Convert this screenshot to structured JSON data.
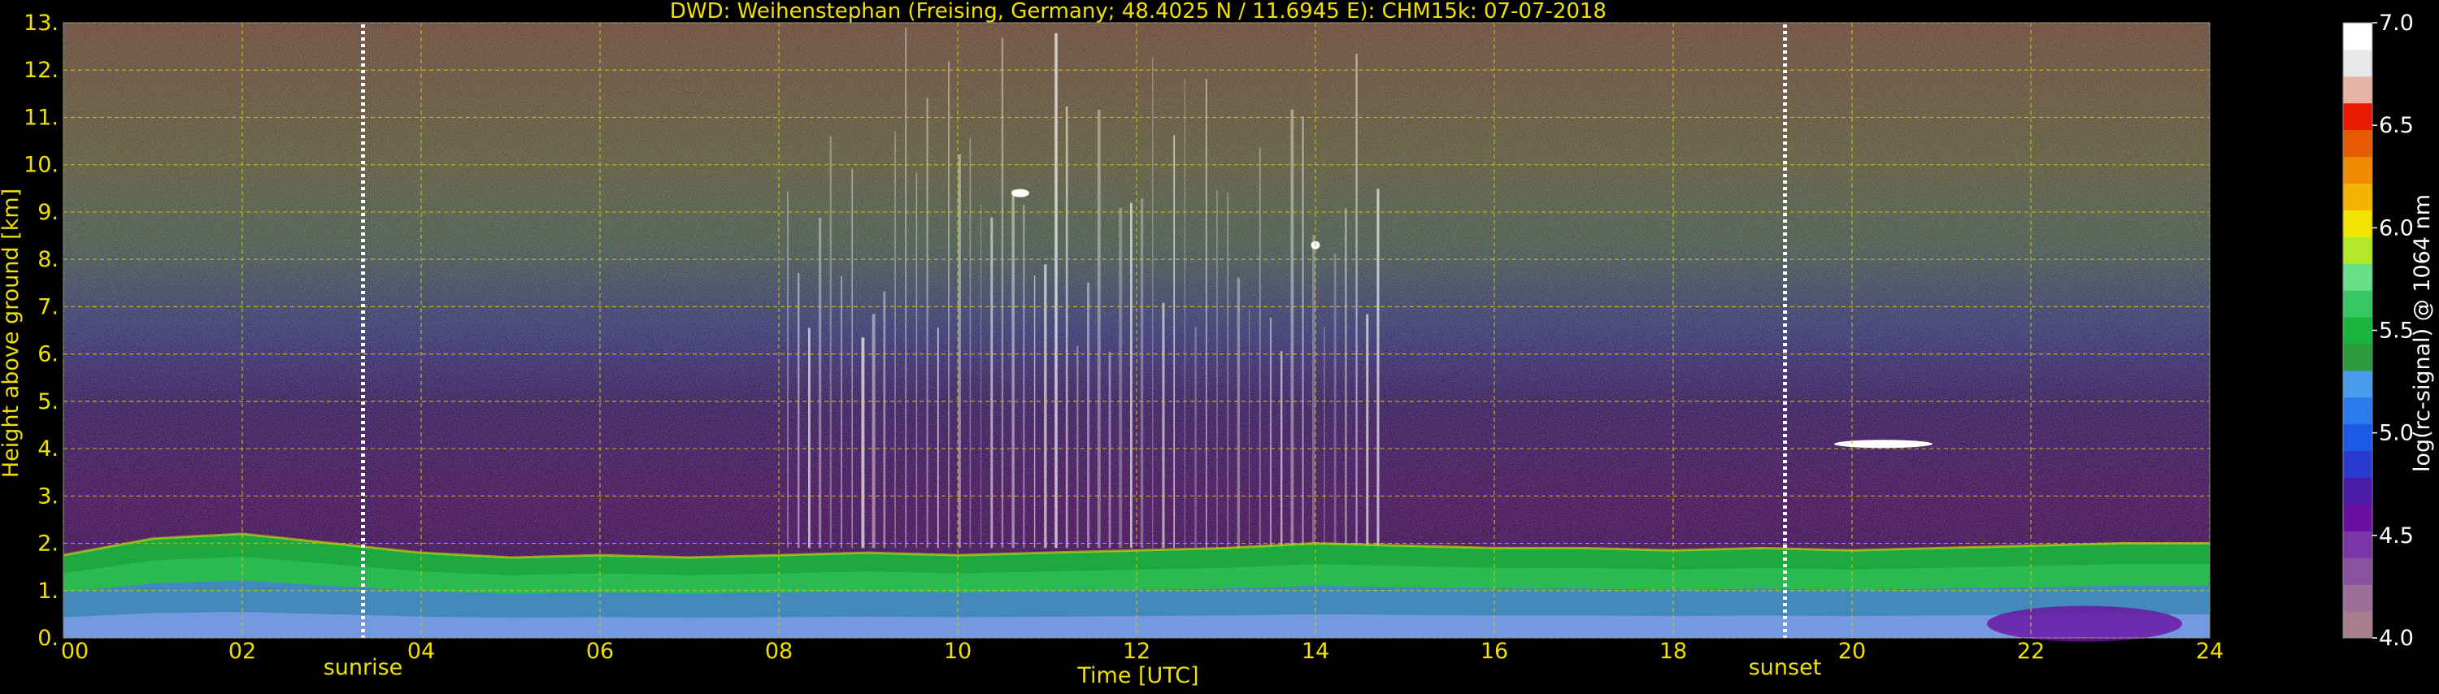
{
  "chart_data": {
    "type": "heatmap",
    "title": "DWD: Weihenstephan (Freising, Germany; 48.4025 N / 11.6945 E):    CHM15k: 07-07-2018",
    "xlabel": "Time [UTC]",
    "ylabel": "Height above ground [km]",
    "xlim": [
      0,
      24
    ],
    "ylim": [
      0,
      13
    ],
    "x_ticks": [
      "00",
      "02",
      "04",
      "06",
      "08",
      "10",
      "12",
      "14",
      "16",
      "18",
      "20",
      "22",
      "24"
    ],
    "y_ticks": [
      "0.",
      "1.",
      "2.",
      "3.",
      "4.",
      "5.",
      "6.",
      "7.",
      "8.",
      "9.",
      "10.",
      "11.",
      "12.",
      "13."
    ],
    "grid": true,
    "colorbar": {
      "label": "log(rc-signal) @ 1064 nm",
      "range": [
        4.0,
        7.0
      ],
      "ticks": [
        "4.0",
        "4.5",
        "5.0",
        "5.5",
        "6.0",
        "6.5",
        "7.0"
      ],
      "colors": [
        "#a57f8e",
        "#9a6f98",
        "#8a52a0",
        "#7a36a4",
        "#6a10a0",
        "#4a1aa8",
        "#2a3ad0",
        "#1a5ae6",
        "#2a7af0",
        "#4a9aee",
        "#2a9a3a",
        "#18b43c",
        "#38c862",
        "#68e08a",
        "#b4e82a",
        "#f0e400",
        "#f4b400",
        "#f08a00",
        "#e85a00",
        "#e81a00",
        "#e8b4a8",
        "#e8e8e8",
        "#ffffff"
      ]
    },
    "annotations": [
      {
        "label": "sunrise",
        "time": 3.35
      },
      {
        "label": "sunset",
        "time": 19.25
      }
    ],
    "layers": [
      {
        "name": "boundary layer top",
        "height_km": [
          1.75,
          2.1,
          2.2,
          2.0,
          1.8,
          1.7,
          1.75,
          1.7,
          1.75,
          1.8,
          1.75,
          1.8,
          1.85,
          1.9,
          2.0,
          1.95,
          1.9,
          1.9,
          1.85,
          1.9,
          1.85,
          1.9,
          1.95,
          2.0,
          2.0
        ],
        "time": [
          0,
          1,
          2,
          3,
          4,
          5,
          6,
          7,
          8,
          9,
          10,
          11,
          12,
          13,
          14,
          15,
          16,
          17,
          18,
          19,
          20,
          21,
          22,
          23,
          24
        ]
      }
    ],
    "clouds": [
      {
        "time": [
          19.8,
          20.9
        ],
        "height_km": 4.1
      },
      {
        "time": [
          10.6,
          10.8
        ],
        "height_km": 9.4
      },
      {
        "time": [
          13.95,
          14.05
        ],
        "height_km": 8.3
      }
    ]
  }
}
